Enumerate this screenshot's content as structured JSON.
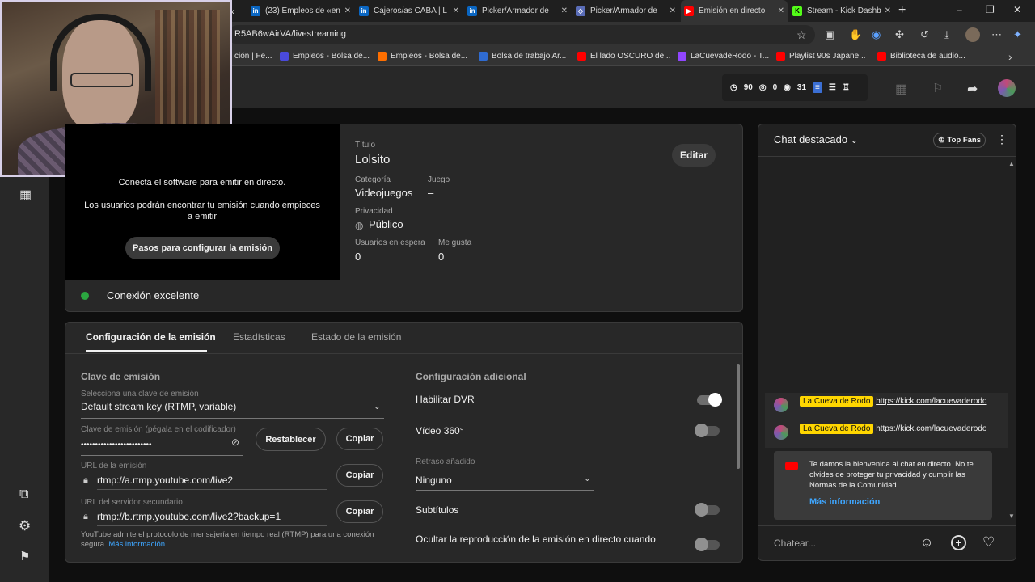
{
  "browser": {
    "tabs": [
      {
        "label": "(23) Empleos de «en",
        "icon": "linkedin-icon",
        "color": "#0a66c2"
      },
      {
        "label": "Cajeros/as CABA | L",
        "icon": "linkedin-icon",
        "color": "#0a66c2"
      },
      {
        "label": "Picker/Armador de",
        "icon": "linkedin-icon",
        "color": "#0a66c2"
      },
      {
        "label": "Picker/Armador de",
        "icon": "bumeran-icon",
        "color": "#5a6db8"
      },
      {
        "label": "Emisión en directo",
        "icon": "youtube-icon",
        "color": "#ff0000"
      },
      {
        "label": "Stream - Kick Dashb",
        "icon": "kick-icon",
        "color": "#53fc18"
      }
    ],
    "url": "R5AB6wAirVA/livestreaming",
    "bookmarks": [
      {
        "label": "ción | Fe...",
        "color": "#555555"
      },
      {
        "label": "Empleos - Bolsa de...",
        "color": "#4a4adb"
      },
      {
        "label": "Empleos - Bolsa de...",
        "color": "#ff6f00"
      },
      {
        "label": "Bolsa de trabajo Ar...",
        "color": "#2f6bd1"
      },
      {
        "label": "El lado OSCURO de...",
        "color": "#ff0000"
      },
      {
        "label": "LaCuevadeRodo - T...",
        "color": "#9146ff"
      },
      {
        "label": "Playlist 90s Japane...",
        "color": "#ff0000"
      },
      {
        "label": "Biblioteca de audio...",
        "color": "#ff0000"
      }
    ]
  },
  "header": {
    "stats": {
      "viewers": "90",
      "likes": "0",
      "watch": "31"
    }
  },
  "preview": {
    "line1": "Conecta el software para emitir en directo.",
    "line2": "Los usuarios podrán encontrar tu emisión cuando empieces a emitir",
    "steps_button": "Pasos para configurar la emisión"
  },
  "details": {
    "title_label": "Título",
    "title_value": "Lolsito",
    "edit_button": "Editar",
    "category_label": "Categoría",
    "category_value": "Videojuegos",
    "game_label": "Juego",
    "game_value": "–",
    "privacy_label": "Privacidad",
    "privacy_value": "Público",
    "waiting_label": "Usuarios en espera",
    "waiting_value": "0",
    "likes_label": "Me gusta",
    "likes_value": "0"
  },
  "connection": {
    "status": "Conexión excelente",
    "color": "#2ba640"
  },
  "settings": {
    "tabs": [
      "Configuración de la emisión",
      "Estadísticas",
      "Estado de la emisión"
    ],
    "stream_key_title": "Clave de emisión",
    "select_key_label": "Selecciona una clave de emisión",
    "select_key_value": "Default stream key (RTMP, variable)",
    "key_label": "Clave de emisión (pégala en el codificador)",
    "key_value": "•••••••••••••••••••••••••",
    "reset_button": "Restablecer",
    "copy_button": "Copiar",
    "url_label": "URL de la emisión",
    "url_value": "rtmp://a.rtmp.youtube.com/live2",
    "backup_label": "URL del servidor secundario",
    "backup_value": "rtmp://b.rtmp.youtube.com/live2?backup=1",
    "footer_text": "YouTube admite el protocolo de mensajería en tiempo real (RTMP) para una conexión segura.",
    "footer_link": "Más información",
    "extra_title": "Configuración adicional",
    "dvr_label": "Habilitar DVR",
    "dvr_on": true,
    "vr_label": "Vídeo 360°",
    "vr_on": false,
    "latency_label": "Retraso añadido",
    "latency_value": "Ninguno",
    "subtitles_label": "Subtítulos",
    "subtitles_on": false,
    "hide_label": "Ocultar la reproducción de la emisión en directo cuando"
  },
  "chat": {
    "title": "Chat destacado",
    "top_fans": "Top Fans",
    "messages": [
      {
        "author": "La Cueva de Rodo",
        "text": "https://kick.com/lacuevaderodo"
      },
      {
        "author": "La Cueva de Rodo",
        "text": "https://kick.com/lacuevaderodo"
      }
    ],
    "welcome": "Te damos la bienvenida al chat en directo. No te olvides de proteger tu privacidad y cumplir las Normas de la Comunidad.",
    "welcome_link": "Más información",
    "input_placeholder": "Chatear..."
  }
}
